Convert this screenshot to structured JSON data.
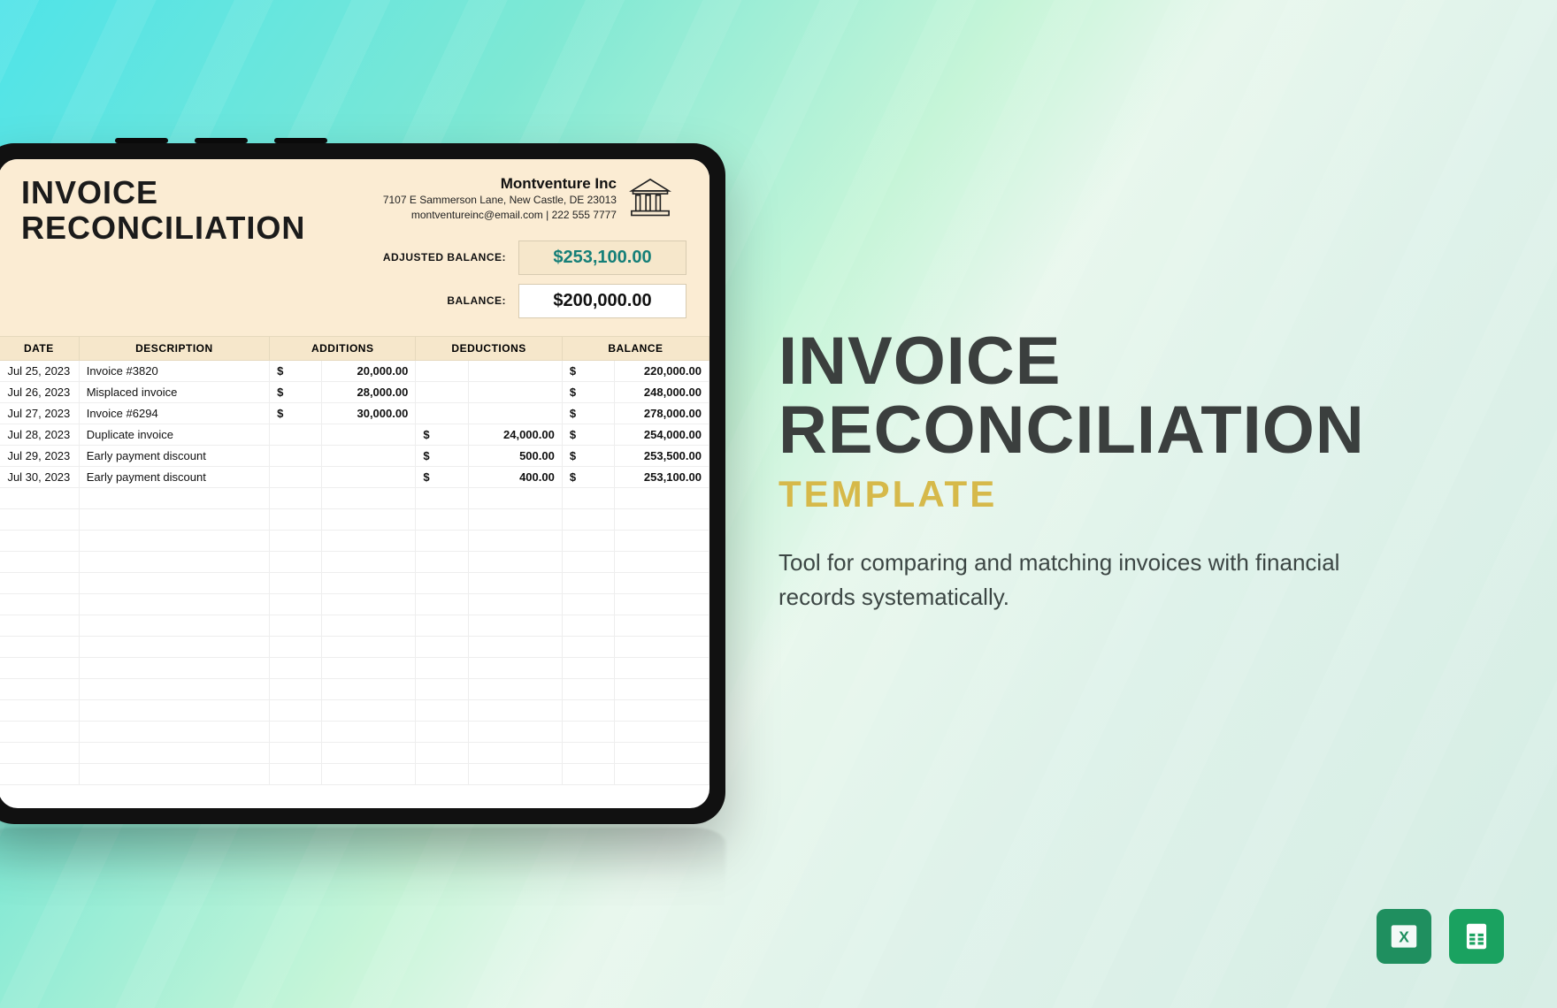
{
  "doc": {
    "title_l1": "INVOICE",
    "title_l2": "RECONCILIATION",
    "company": {
      "name": "Montventure Inc",
      "address": "7107 E Sammerson Lane, New Castle, DE 23013",
      "contact": "montventureinc@email.com | 222 555 7777"
    },
    "summary": {
      "adjusted_label": "ADJUSTED BALANCE:",
      "adjusted_value": "$253,100.00",
      "balance_label": "BALANCE:",
      "balance_value": "$200,000.00"
    },
    "columns": {
      "date": "DATE",
      "description": "DESCRIPTION",
      "additions": "ADDITIONS",
      "deductions": "DEDUCTIONS",
      "balance": "BALANCE"
    },
    "rows": [
      {
        "date": "Jul 25, 2023",
        "desc": "Invoice #3820",
        "add": "20,000.00",
        "ded": "",
        "bal": "220,000.00"
      },
      {
        "date": "Jul 26, 2023",
        "desc": "Misplaced invoice",
        "add": "28,000.00",
        "ded": "",
        "bal": "248,000.00"
      },
      {
        "date": "Jul 27, 2023",
        "desc": "Invoice #6294",
        "add": "30,000.00",
        "ded": "",
        "bal": "278,000.00"
      },
      {
        "date": "Jul 28, 2023",
        "desc": "Duplicate invoice",
        "add": "",
        "ded": "24,000.00",
        "bal": "254,000.00"
      },
      {
        "date": "Jul 29, 2023",
        "desc": "Early payment discount",
        "add": "",
        "ded": "500.00",
        "bal": "253,500.00"
      },
      {
        "date": "Jul 30, 2023",
        "desc": "Early payment discount",
        "add": "",
        "ded": "400.00",
        "bal": "253,100.00"
      }
    ],
    "currency": "$"
  },
  "promo": {
    "heading_l1": "INVOICE",
    "heading_l2": "RECONCILIATION",
    "subheading": "TEMPLATE",
    "body": "Tool for comparing and matching invoices with financial records systematically."
  },
  "apps": {
    "excel_label": "Excel",
    "sheets_label": "Google Sheets"
  }
}
